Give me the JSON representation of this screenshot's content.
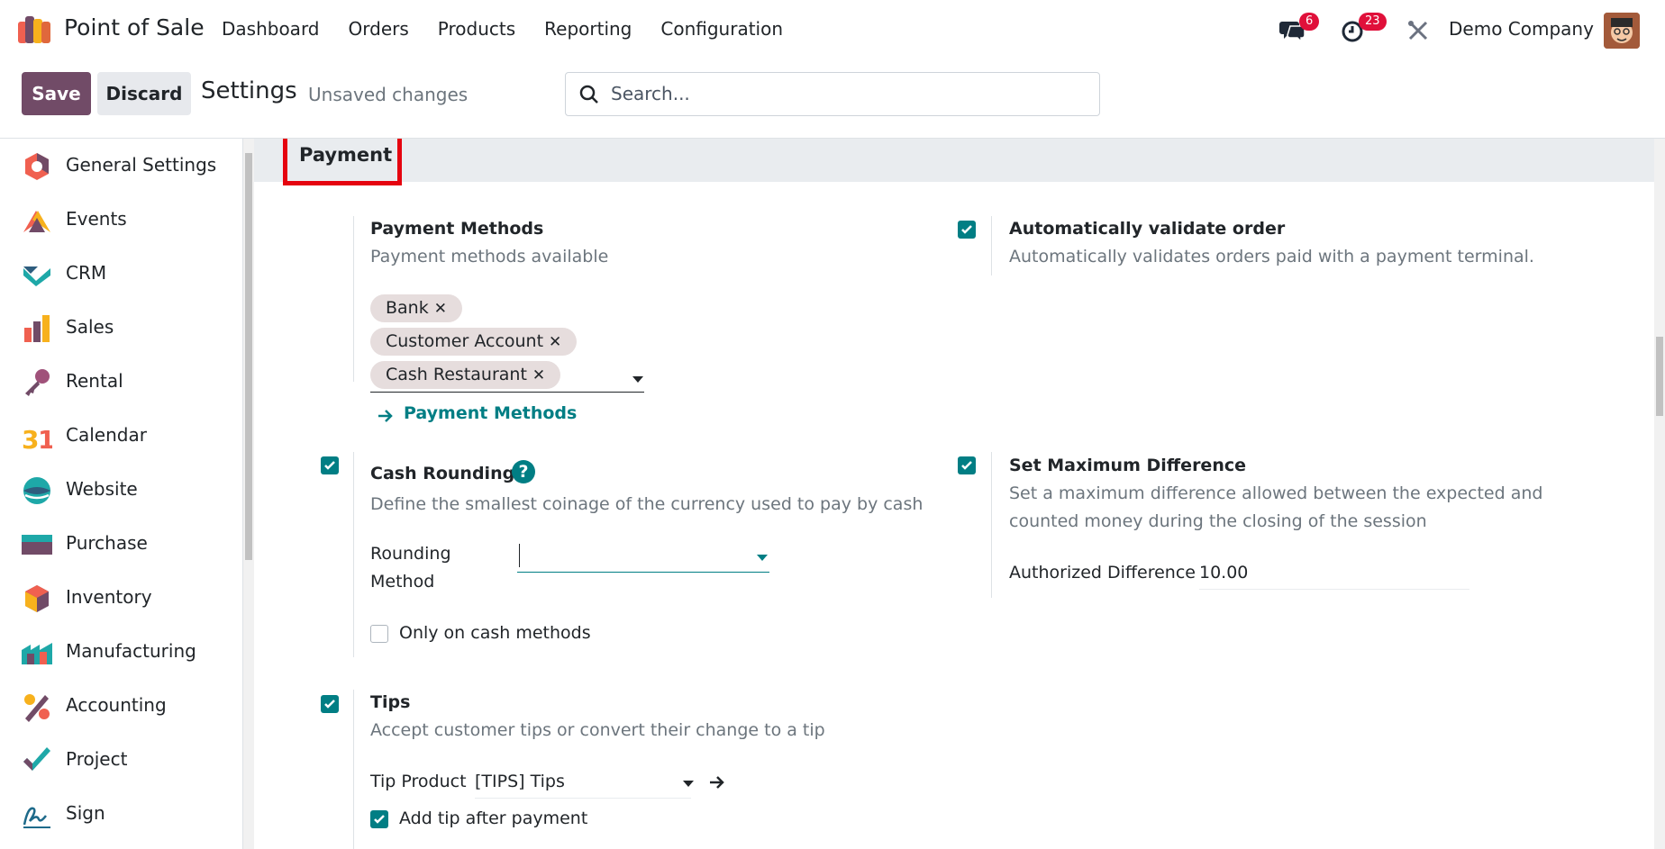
{
  "app": {
    "title": "Point of Sale"
  },
  "nav": {
    "menu": [
      "Dashboard",
      "Orders",
      "Products",
      "Reporting",
      "Configuration"
    ],
    "messages_count": "6",
    "activities_count": "23",
    "company": "Demo Company"
  },
  "control": {
    "save_label": "Save",
    "discard_label": "Discard",
    "title": "Settings",
    "status": "Unsaved changes",
    "search_placeholder": "Search..."
  },
  "sidebar": {
    "items": [
      {
        "label": "General Settings",
        "icon": "general-settings-icon"
      },
      {
        "label": "Events",
        "icon": "events-icon"
      },
      {
        "label": "CRM",
        "icon": "crm-icon"
      },
      {
        "label": "Sales",
        "icon": "sales-icon"
      },
      {
        "label": "Rental",
        "icon": "rental-icon"
      },
      {
        "label": "Calendar",
        "icon": "calendar-icon"
      },
      {
        "label": "Website",
        "icon": "website-icon"
      },
      {
        "label": "Purchase",
        "icon": "purchase-icon"
      },
      {
        "label": "Inventory",
        "icon": "inventory-icon"
      },
      {
        "label": "Manufacturing",
        "icon": "manufacturing-icon"
      },
      {
        "label": "Accounting",
        "icon": "accounting-icon"
      },
      {
        "label": "Project",
        "icon": "project-icon"
      },
      {
        "label": "Sign",
        "icon": "sign-icon"
      }
    ]
  },
  "section": {
    "title": "Payment"
  },
  "payment_methods": {
    "label": "Payment Methods",
    "description": "Payment methods available",
    "tags": [
      "Bank",
      "Customer Account",
      "Cash Restaurant"
    ],
    "link": "Payment Methods"
  },
  "auto_validate": {
    "checked": true,
    "label": "Automatically validate order",
    "description": "Automatically validates orders paid with a payment terminal."
  },
  "cash_rounding": {
    "checked": true,
    "label": "Cash Rounding",
    "description": "Define the smallest coinage of the currency used to pay by cash",
    "rounding_label_line1": "Rounding",
    "rounding_label_line2": "Method",
    "rounding_value": "",
    "only_cash_label": "Only on cash methods",
    "only_cash_checked": false
  },
  "max_difference": {
    "checked": true,
    "label": "Set Maximum Difference",
    "description_line1": "Set a maximum difference allowed between the expected and",
    "description_line2": "counted money during the closing of the session",
    "authorized_label": "Authorized Difference",
    "authorized_value": "10.00"
  },
  "tips": {
    "checked": true,
    "label": "Tips",
    "description": "Accept customer tips or convert their change to a tip",
    "product_label": "Tip Product",
    "product_value": "[TIPS] Tips",
    "after_payment_label": "Add tip after payment",
    "after_payment_checked": true
  },
  "colors": {
    "brand": "#714b67",
    "accent": "#017e84",
    "badge": "#e0103a",
    "highlight": "#e5030f"
  }
}
